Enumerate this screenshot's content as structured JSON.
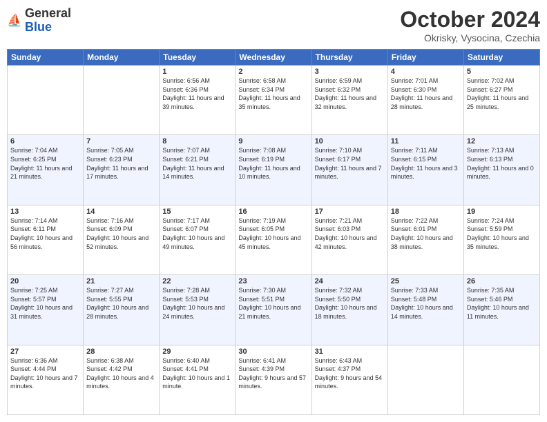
{
  "logo": {
    "text_general": "General",
    "text_blue": "Blue"
  },
  "header": {
    "month": "October 2024",
    "location": "Okrisky, Vysocina, Czechia"
  },
  "weekdays": [
    "Sunday",
    "Monday",
    "Tuesday",
    "Wednesday",
    "Thursday",
    "Friday",
    "Saturday"
  ],
  "weeks": [
    [
      {
        "day": "",
        "sunrise": "",
        "sunset": "",
        "daylight": ""
      },
      {
        "day": "",
        "sunrise": "",
        "sunset": "",
        "daylight": ""
      },
      {
        "day": "1",
        "sunrise": "Sunrise: 6:56 AM",
        "sunset": "Sunset: 6:36 PM",
        "daylight": "Daylight: 11 hours and 39 minutes."
      },
      {
        "day": "2",
        "sunrise": "Sunrise: 6:58 AM",
        "sunset": "Sunset: 6:34 PM",
        "daylight": "Daylight: 11 hours and 35 minutes."
      },
      {
        "day": "3",
        "sunrise": "Sunrise: 6:59 AM",
        "sunset": "Sunset: 6:32 PM",
        "daylight": "Daylight: 11 hours and 32 minutes."
      },
      {
        "day": "4",
        "sunrise": "Sunrise: 7:01 AM",
        "sunset": "Sunset: 6:30 PM",
        "daylight": "Daylight: 11 hours and 28 minutes."
      },
      {
        "day": "5",
        "sunrise": "Sunrise: 7:02 AM",
        "sunset": "Sunset: 6:27 PM",
        "daylight": "Daylight: 11 hours and 25 minutes."
      }
    ],
    [
      {
        "day": "6",
        "sunrise": "Sunrise: 7:04 AM",
        "sunset": "Sunset: 6:25 PM",
        "daylight": "Daylight: 11 hours and 21 minutes."
      },
      {
        "day": "7",
        "sunrise": "Sunrise: 7:05 AM",
        "sunset": "Sunset: 6:23 PM",
        "daylight": "Daylight: 11 hours and 17 minutes."
      },
      {
        "day": "8",
        "sunrise": "Sunrise: 7:07 AM",
        "sunset": "Sunset: 6:21 PM",
        "daylight": "Daylight: 11 hours and 14 minutes."
      },
      {
        "day": "9",
        "sunrise": "Sunrise: 7:08 AM",
        "sunset": "Sunset: 6:19 PM",
        "daylight": "Daylight: 11 hours and 10 minutes."
      },
      {
        "day": "10",
        "sunrise": "Sunrise: 7:10 AM",
        "sunset": "Sunset: 6:17 PM",
        "daylight": "Daylight: 11 hours and 7 minutes."
      },
      {
        "day": "11",
        "sunrise": "Sunrise: 7:11 AM",
        "sunset": "Sunset: 6:15 PM",
        "daylight": "Daylight: 11 hours and 3 minutes."
      },
      {
        "day": "12",
        "sunrise": "Sunrise: 7:13 AM",
        "sunset": "Sunset: 6:13 PM",
        "daylight": "Daylight: 11 hours and 0 minutes."
      }
    ],
    [
      {
        "day": "13",
        "sunrise": "Sunrise: 7:14 AM",
        "sunset": "Sunset: 6:11 PM",
        "daylight": "Daylight: 10 hours and 56 minutes."
      },
      {
        "day": "14",
        "sunrise": "Sunrise: 7:16 AM",
        "sunset": "Sunset: 6:09 PM",
        "daylight": "Daylight: 10 hours and 52 minutes."
      },
      {
        "day": "15",
        "sunrise": "Sunrise: 7:17 AM",
        "sunset": "Sunset: 6:07 PM",
        "daylight": "Daylight: 10 hours and 49 minutes."
      },
      {
        "day": "16",
        "sunrise": "Sunrise: 7:19 AM",
        "sunset": "Sunset: 6:05 PM",
        "daylight": "Daylight: 10 hours and 45 minutes."
      },
      {
        "day": "17",
        "sunrise": "Sunrise: 7:21 AM",
        "sunset": "Sunset: 6:03 PM",
        "daylight": "Daylight: 10 hours and 42 minutes."
      },
      {
        "day": "18",
        "sunrise": "Sunrise: 7:22 AM",
        "sunset": "Sunset: 6:01 PM",
        "daylight": "Daylight: 10 hours and 38 minutes."
      },
      {
        "day": "19",
        "sunrise": "Sunrise: 7:24 AM",
        "sunset": "Sunset: 5:59 PM",
        "daylight": "Daylight: 10 hours and 35 minutes."
      }
    ],
    [
      {
        "day": "20",
        "sunrise": "Sunrise: 7:25 AM",
        "sunset": "Sunset: 5:57 PM",
        "daylight": "Daylight: 10 hours and 31 minutes."
      },
      {
        "day": "21",
        "sunrise": "Sunrise: 7:27 AM",
        "sunset": "Sunset: 5:55 PM",
        "daylight": "Daylight: 10 hours and 28 minutes."
      },
      {
        "day": "22",
        "sunrise": "Sunrise: 7:28 AM",
        "sunset": "Sunset: 5:53 PM",
        "daylight": "Daylight: 10 hours and 24 minutes."
      },
      {
        "day": "23",
        "sunrise": "Sunrise: 7:30 AM",
        "sunset": "Sunset: 5:51 PM",
        "daylight": "Daylight: 10 hours and 21 minutes."
      },
      {
        "day": "24",
        "sunrise": "Sunrise: 7:32 AM",
        "sunset": "Sunset: 5:50 PM",
        "daylight": "Daylight: 10 hours and 18 minutes."
      },
      {
        "day": "25",
        "sunrise": "Sunrise: 7:33 AM",
        "sunset": "Sunset: 5:48 PM",
        "daylight": "Daylight: 10 hours and 14 minutes."
      },
      {
        "day": "26",
        "sunrise": "Sunrise: 7:35 AM",
        "sunset": "Sunset: 5:46 PM",
        "daylight": "Daylight: 10 hours and 11 minutes."
      }
    ],
    [
      {
        "day": "27",
        "sunrise": "Sunrise: 6:36 AM",
        "sunset": "Sunset: 4:44 PM",
        "daylight": "Daylight: 10 hours and 7 minutes."
      },
      {
        "day": "28",
        "sunrise": "Sunrise: 6:38 AM",
        "sunset": "Sunset: 4:42 PM",
        "daylight": "Daylight: 10 hours and 4 minutes."
      },
      {
        "day": "29",
        "sunrise": "Sunrise: 6:40 AM",
        "sunset": "Sunset: 4:41 PM",
        "daylight": "Daylight: 10 hours and 1 minute."
      },
      {
        "day": "30",
        "sunrise": "Sunrise: 6:41 AM",
        "sunset": "Sunset: 4:39 PM",
        "daylight": "Daylight: 9 hours and 57 minutes."
      },
      {
        "day": "31",
        "sunrise": "Sunrise: 6:43 AM",
        "sunset": "Sunset: 4:37 PM",
        "daylight": "Daylight: 9 hours and 54 minutes."
      },
      {
        "day": "",
        "sunrise": "",
        "sunset": "",
        "daylight": ""
      },
      {
        "day": "",
        "sunrise": "",
        "sunset": "",
        "daylight": ""
      }
    ]
  ]
}
